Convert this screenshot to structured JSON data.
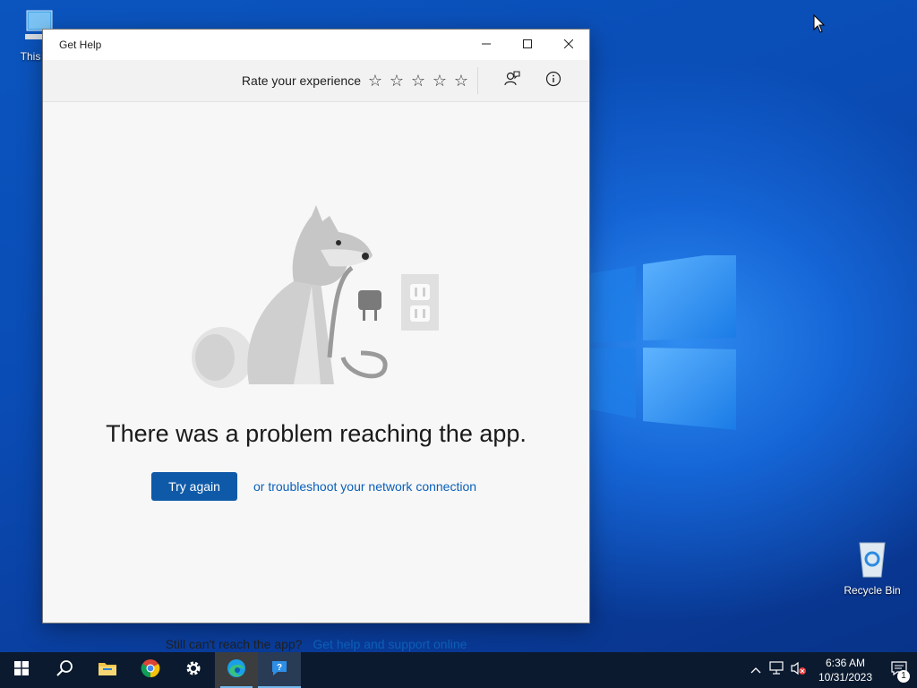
{
  "desktop": {
    "icons": [
      {
        "label": "This PC",
        "icon": "computer-icon"
      },
      {
        "label": "Recycle Bin",
        "icon": "recycle-bin-icon"
      }
    ]
  },
  "window": {
    "title": "Get Help",
    "caption": {
      "minimize": "minimize-icon",
      "maximize": "maximize-icon",
      "close": "close-icon"
    },
    "commandbar": {
      "rate_label": "Rate your experience",
      "stars": [
        "☆",
        "☆",
        "☆",
        "☆",
        "☆"
      ],
      "rating": 0,
      "feedback_icon": "feedback-icon",
      "info_icon": "info-icon"
    },
    "error": {
      "headline": "There was a problem reaching the app.",
      "try_again": "Try again",
      "troubleshoot_link": "or troubleshoot your network connection",
      "still_text": "Still can't reach the app?",
      "support_link": "Get help and support online"
    }
  },
  "taskbar": {
    "apps": [
      "start-icon",
      "search-icon",
      "file-explorer-icon",
      "chrome-icon",
      "settings-icon",
      "edge-icon",
      "get-help-icon"
    ],
    "time": "6:36 AM",
    "date": "10/31/2023",
    "notification_count": "1"
  },
  "colors": {
    "accent": "#0f5aa8",
    "link": "#0b5fb8",
    "taskbar": "#0b1a2f"
  }
}
